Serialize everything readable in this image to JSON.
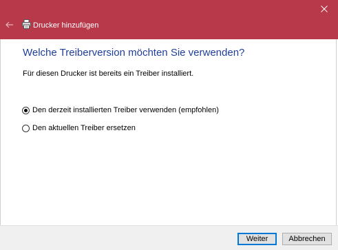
{
  "window": {
    "title": "Drucker hinzufügen",
    "accent_color": "#b8394a"
  },
  "main": {
    "heading": "Welche Treiberversion möchten Sie verwenden?",
    "info": "Für diesen Drucker ist bereits ein Treiber installiert.",
    "options": [
      {
        "label": "Den derzeit installierten Treiber verwenden (empfohlen)",
        "selected": true
      },
      {
        "label": "Den aktuellen Treiber ersetzen",
        "selected": false
      }
    ]
  },
  "footer": {
    "next_label": "Weiter",
    "cancel_label": "Abbrechen"
  },
  "icons": {
    "close": "close-icon",
    "back": "back-arrow-icon",
    "printer": "printer-icon"
  }
}
